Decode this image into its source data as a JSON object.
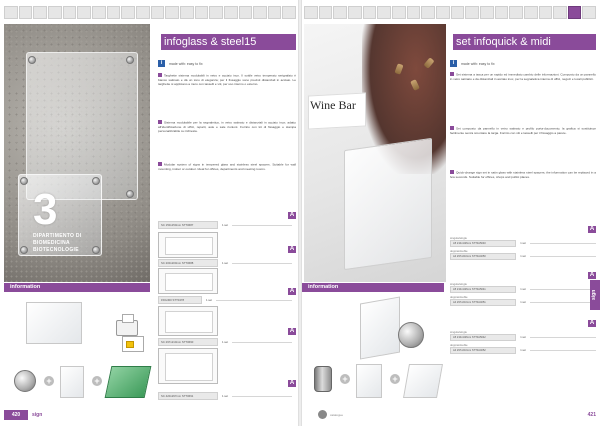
{
  "colors": {
    "accent": "#8a4b9a",
    "icon_blue": "#2b5fa8",
    "badge_yellow": "#f2c20c"
  },
  "left_page": {
    "header": "infoglass & steel15",
    "tagline": "made with: easy to fix",
    "photo": {
      "numeral": "3",
      "sign_text": "DIPARTIMENTO DI BIOMEDICINA BIOTECNOLOGIE"
    },
    "paragraphs": [
      "Targhette sistema modulabili in vetro e acciaio inox. Il sottile vetro temperato serigrafato è bianco satinato e dà un tono di eleganza; per il fissaggio sono previsti distanziali in acciaio. Le targhette si applicano a muro con tasselli e viti, per uso interno o esterno.",
      "Sistema modulabile per la segnaletica, in vetro satinato e distanziali in acciaio inox; adatto all’identificazione di uffici, reparti, aule e sale riunioni. Fornito con kit di fissaggio e stampa personalizzabile su richiesta.",
      "Modular system of signs in tempered glass and stainless steel spacers. Suitable for wall mounting, indoor or outdoor. Ideal for offices, departments and meeting rooms."
    ],
    "orders": [
      {
        "code": "SC 150x150mm STT0687",
        "qty": "1 set",
        "badge": "A"
      },
      {
        "code": "SC 200x200mm STT0688",
        "qty": "1 set",
        "badge": "A"
      },
      {
        "code": "150x300 STT0478",
        "qty": "1 set",
        "badge": "A"
      },
      {
        "code": "SC 297x210mm STT0690",
        "qty": "1 set",
        "badge": "A"
      },
      {
        "code": "SC 420x297mm STT0691",
        "qty": "1 set",
        "badge": "A"
      }
    ],
    "info_label": "information",
    "page_number": "420",
    "footer_word": "sign"
  },
  "right_page": {
    "header": "set infoquick & midi",
    "tagline": "made with: easy to fix",
    "photo": {
      "brand_text": "Wine Bar"
    },
    "paragraphs": [
      "Set sistema a tasca per un rapido ed immediato cambio delle informazioni. Composto da un pannello in vetro satinato e da distanziali in acciaio inox, per la segnaletica interna di uffici, negozi e locali pubblici.",
      "Set composto da pannello in vetro satinato e profilo porta-documento; la grafica si sostituisce facilmente senza smontare la targa. Fornito con viti e tasselli per il fissaggio a parete.",
      "Quick-change sign set in satin glass with stainless steel spacers; the information can be replaced in a few seconds. Suitable for offices, shops and public places."
    ],
    "orders": [
      {
        "label": "singola/single",
        "code": "A5 210x148mm STT0A5040",
        "qty": "1 set",
        "badge": "A"
      },
      {
        "label": "doppia/double",
        "code": "A4 297x210mm STT0A4050",
        "qty": "1 set",
        "badge": "A"
      },
      {
        "label": "singola/single",
        "code": "A5 210x148mm STT0A5041",
        "qty": "1 set",
        "badge": "A"
      },
      {
        "label": "doppia/double",
        "code": "A4 297x210mm STT0A4051",
        "qty": "1 set",
        "badge": "A"
      },
      {
        "label": "singola/single",
        "code": "A5 210x148mm STT0A5042",
        "qty": "1 set",
        "badge": "A"
      },
      {
        "label": "doppia/double",
        "code": "A4 297x210mm STT0A4052",
        "qty": "1 set",
        "badge": "A"
      }
    ],
    "info_label": "information",
    "page_number": "421",
    "side_tab": "sign",
    "footer_note": "catalogue"
  }
}
